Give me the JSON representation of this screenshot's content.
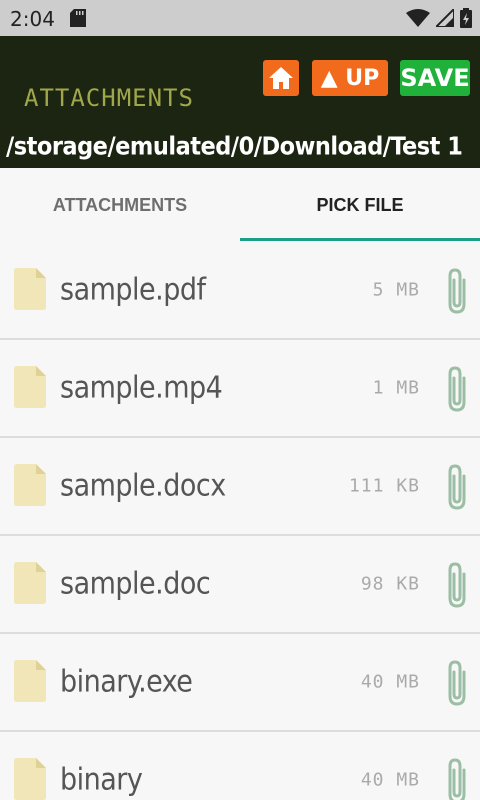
{
  "status_bar": {
    "time": "2:04",
    "icons": [
      "sd-card-icon",
      "wifi-icon",
      "signal-icon",
      "battery-icon"
    ]
  },
  "toolbar": {
    "title": "ATTACHMENTS",
    "home_icon": "home-icon",
    "up_label": "▲ UP",
    "save_label": "SAVE",
    "path": "/storage/emulated/0/Download/Test 1",
    "colors": {
      "background": "#1c2412",
      "title": "#b8bf55",
      "home": "#f26b1d",
      "up": "#f26b1d",
      "save": "#1fb13a"
    }
  },
  "tabs": [
    {
      "label": "ATTACHMENTS",
      "active": false
    },
    {
      "label": "PICK FILE",
      "active": true
    }
  ],
  "tab_indicator_color": "#1b9e8a",
  "files": [
    {
      "name": "sample.pdf",
      "size": "5 MB"
    },
    {
      "name": "sample.mp4",
      "size": "1 MB"
    },
    {
      "name": "sample.docx",
      "size": "111 KB"
    },
    {
      "name": "sample.doc",
      "size": "98 KB"
    },
    {
      "name": "binary.exe",
      "size": "40 MB"
    },
    {
      "name": "binary",
      "size": "40 MB"
    }
  ],
  "icons": {
    "file": "file-icon",
    "attach": "paperclip-icon"
  }
}
